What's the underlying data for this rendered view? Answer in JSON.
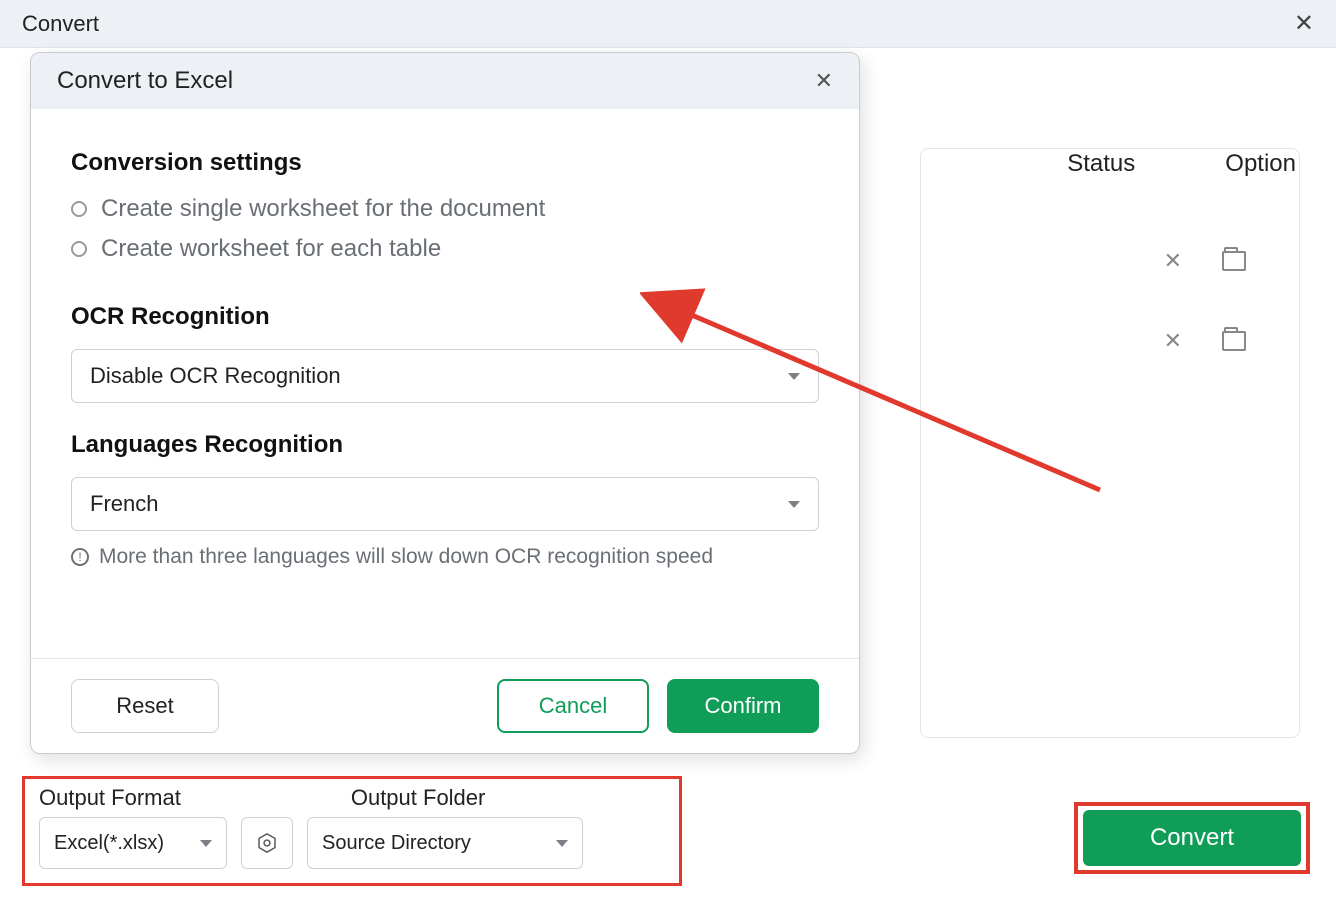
{
  "outer": {
    "title": "Convert"
  },
  "modal": {
    "title": "Convert to Excel",
    "sections": {
      "conversion_title": "Conversion settings",
      "radio_single": "Create single worksheet for the document",
      "radio_each": "Create worksheet for each table",
      "ocr_title": "OCR Recognition",
      "ocr_value": "Disable OCR Recognition",
      "lang_title": "Languages Recognition",
      "lang_value": "French",
      "hint": "More than three languages will slow down OCR recognition speed"
    },
    "buttons": {
      "reset": "Reset",
      "cancel": "Cancel",
      "confirm": "Confirm"
    }
  },
  "bg": {
    "status_header": "Status",
    "option_header": "Option"
  },
  "bottom": {
    "format_label": "Output Format",
    "folder_label": "Output Folder",
    "format_value": "Excel(*.xlsx)",
    "folder_value": "Source Directory",
    "convert": "Convert"
  },
  "info_glyph": "!"
}
